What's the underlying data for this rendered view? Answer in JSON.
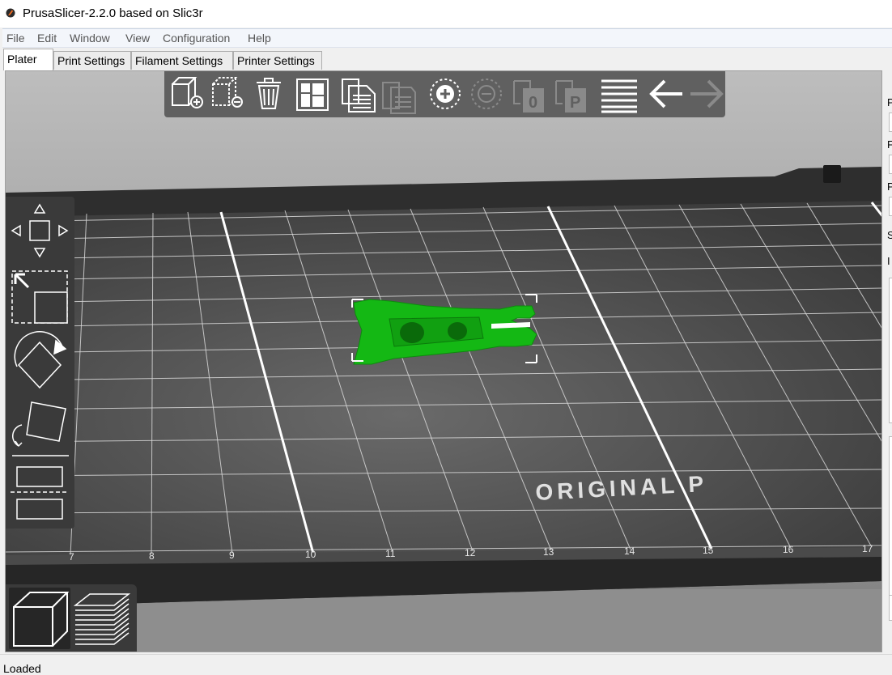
{
  "window": {
    "title": "PrusaSlicer-2.2.0 based on Slic3r"
  },
  "menu": [
    "File",
    "Edit",
    "Window",
    "View",
    "Configuration",
    "Help"
  ],
  "tabs": [
    {
      "label": "Plater",
      "active": true
    },
    {
      "label": "Print Settings",
      "active": false
    },
    {
      "label": "Filament Settings",
      "active": false
    },
    {
      "label": "Printer Settings",
      "active": false
    }
  ],
  "toolbar": {
    "items": [
      "add-object-icon",
      "delete-object-icon",
      "delete-all-icon",
      "arrange-icon",
      "copy-icon",
      "paste-icon",
      "add-instance-icon",
      "remove-instance-icon",
      "split-objects-icon",
      "split-parts-icon",
      "layers-editing-icon",
      "undo-icon",
      "redo-icon"
    ]
  },
  "gizmos": [
    "move-icon",
    "scale-icon",
    "rotate-icon",
    "place-on-face-icon",
    "cut-icon"
  ],
  "view_toggle": [
    "view-3d-icon",
    "preview-layers-icon"
  ],
  "bed": {
    "logo_text": "ORIGINAL P",
    "ruler_labels": [
      "7",
      "8",
      "9",
      "10",
      "11",
      "12",
      "13",
      "14",
      "15",
      "16",
      "17"
    ]
  },
  "right_panel": {
    "labels": [
      "P",
      "F",
      "P",
      "S",
      "I"
    ]
  },
  "status": {
    "text": "Loaded"
  },
  "colors": {
    "model": "#14b814",
    "bed": "#3b3b3b",
    "toolbar_bg": "#606060"
  }
}
